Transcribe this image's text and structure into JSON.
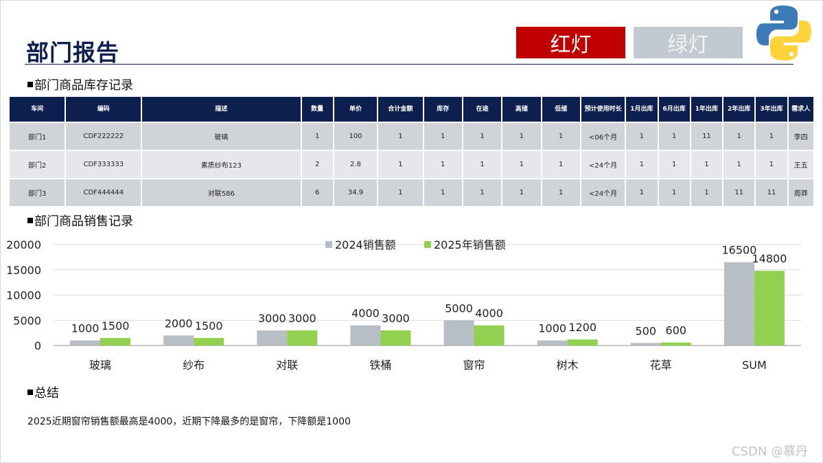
{
  "header": {
    "title": "部门报告",
    "red_button": "红灯",
    "green_button": "绿灯",
    "logo_icon": "python-logo-icon"
  },
  "inventory": {
    "section_title": "部门商品库存记录",
    "columns": [
      "车间",
      "编码",
      "描述",
      "数量",
      "单价",
      "合计金额",
      "库存",
      "在途",
      "高储",
      "低储",
      "预计使用时长",
      "1月出库",
      "6月出库",
      "1年出库",
      "2年出库",
      "3年出库",
      "需求人"
    ],
    "rows": [
      [
        "部门1",
        "CDF222222",
        "玻璃",
        "1",
        "100",
        "1",
        "1",
        "1",
        "1",
        "1",
        "<06个月",
        "1",
        "1",
        "11",
        "1",
        "1",
        "李四"
      ],
      [
        "部门2",
        "CDF333333",
        "素质纱布123",
        "2",
        "2.8",
        "1",
        "1",
        "1",
        "1",
        "1",
        "<24个月",
        "1",
        "1",
        "1",
        "1",
        "1",
        "王五"
      ],
      [
        "部门3",
        "CDF444444",
        "对联586",
        "6",
        "34.9",
        "1",
        "1",
        "1",
        "1",
        "1",
        "<24个月",
        "1",
        "1",
        "1",
        "11",
        "11",
        "周莽"
      ]
    ]
  },
  "sales": {
    "section_title": "部门商品销售记录"
  },
  "chart_data": {
    "type": "bar",
    "categories": [
      "玻璃",
      "纱布",
      "对联",
      "铁桶",
      "窗帘",
      "树木",
      "花草",
      "SUM"
    ],
    "series": [
      {
        "name": "2024销售额",
        "values": [
          1000,
          2000,
          3000,
          4000,
          5000,
          1000,
          500,
          16500
        ],
        "color": "#b8bec6"
      },
      {
        "name": "2025年销售额",
        "values": [
          1500,
          1500,
          3000,
          3000,
          4000,
          1200,
          600,
          14800
        ],
        "color": "#92d050"
      }
    ],
    "yticks": [
      "0",
      "5000",
      "10000",
      "15000",
      "20000"
    ],
    "ylim": [
      0,
      20000
    ],
    "grid": true,
    "legend": "top-center"
  },
  "summary": {
    "section_title": "总结",
    "text": "2025近期窗帘销售额最高是4000，近期下降最多的是窗帘，下降额是1000"
  },
  "watermark": "CSDN @慕丹"
}
